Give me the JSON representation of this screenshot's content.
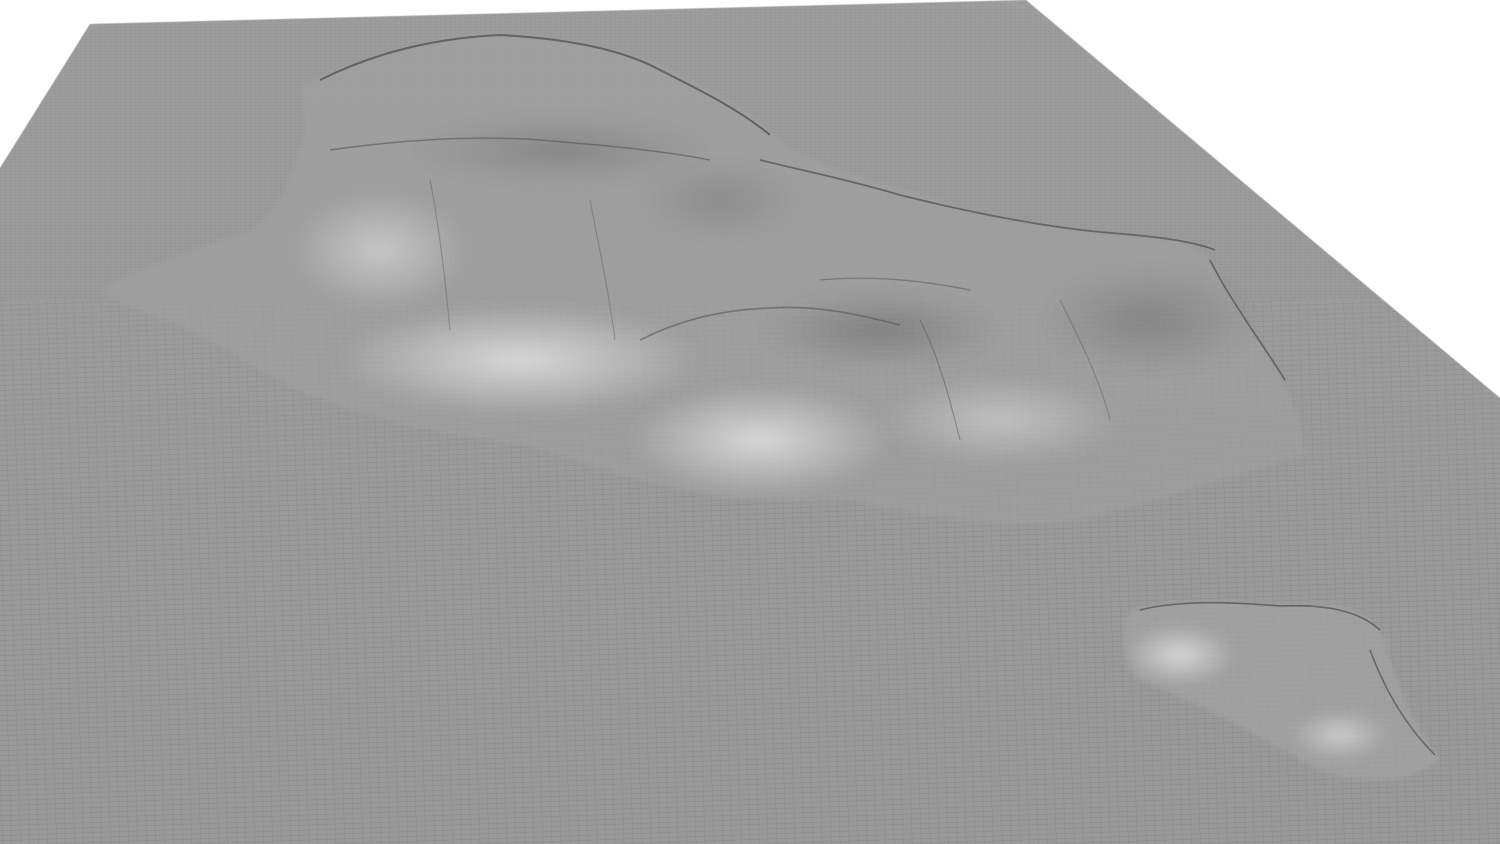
{
  "scene": {
    "background_color": "#ffffff",
    "ground_color": "#9a9a9a",
    "wire_color": "#5e5e5e",
    "highlight_color": "#d9d9d9",
    "shadow_color": "#4a4a4a"
  }
}
